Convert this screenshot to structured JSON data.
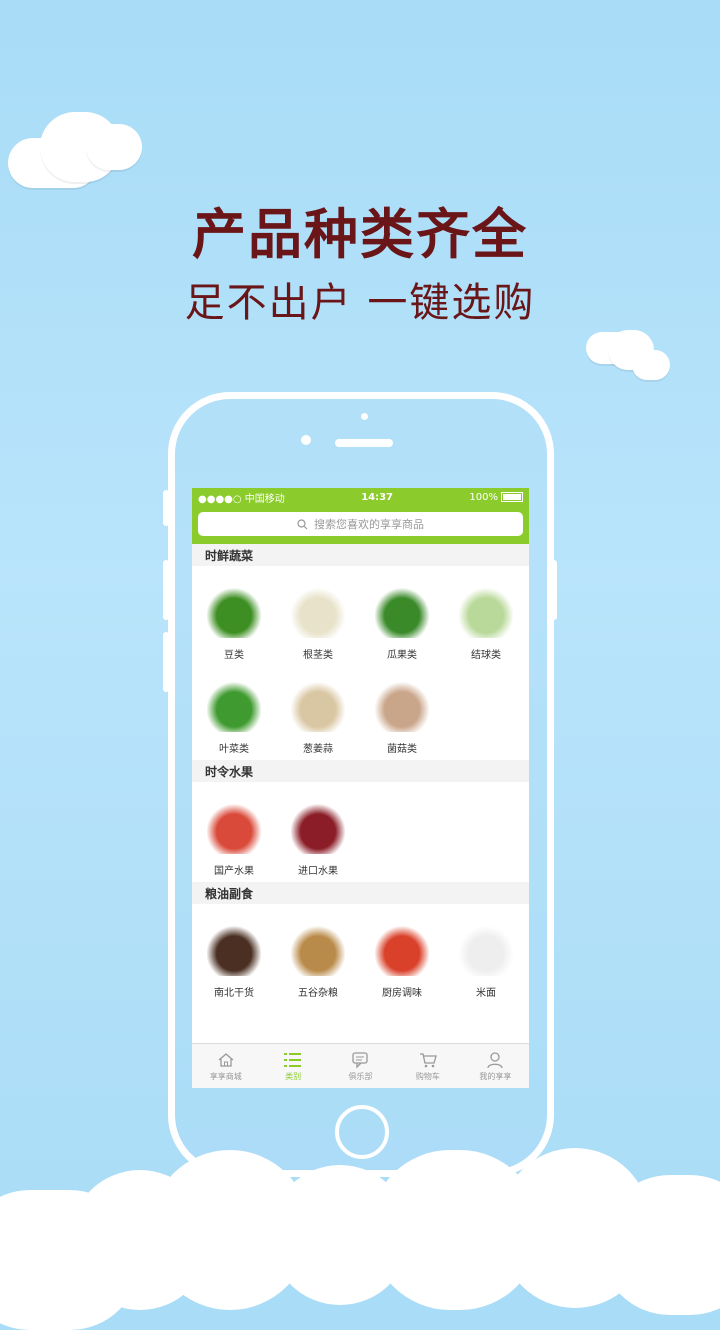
{
  "promo": {
    "title": "产品种类齐全",
    "subtitle": "足不出户 一键选购"
  },
  "status_bar": {
    "carrier": "●●●●○ 中国移动",
    "time": "14:37",
    "battery": "100%"
  },
  "search": {
    "placeholder": "搜索您喜欢的享享商品"
  },
  "sections": [
    {
      "title": "时鲜蔬菜",
      "items": [
        {
          "label": "豆类",
          "color": "#3e8f23"
        },
        {
          "label": "根茎类",
          "color": "#e7e2c9"
        },
        {
          "label": "瓜果类",
          "color": "#3a8a2a"
        },
        {
          "label": "结球类",
          "color": "#b9d99a"
        },
        {
          "label": "叶菜类",
          "color": "#3f9a2f"
        },
        {
          "label": "葱姜蒜",
          "color": "#d9c6a2"
        },
        {
          "label": "菌菇类",
          "color": "#c9a58a"
        }
      ]
    },
    {
      "title": "时令水果",
      "items": [
        {
          "label": "国产水果",
          "color": "#d94a3a"
        },
        {
          "label": "进口水果",
          "color": "#8a1d27"
        }
      ]
    },
    {
      "title": "粮油副食",
      "items": [
        {
          "label": "南北干货",
          "color": "#4a2f22"
        },
        {
          "label": "五谷杂粮",
          "color": "#b98b4a"
        },
        {
          "label": "厨房调味",
          "color": "#d9412a"
        },
        {
          "label": "米面",
          "color": "#eeeeee"
        }
      ]
    }
  ],
  "tabbar": [
    {
      "label": "享享商城",
      "icon": "home-icon"
    },
    {
      "label": "类别",
      "icon": "list-icon"
    },
    {
      "label": "俱乐部",
      "icon": "chat-icon"
    },
    {
      "label": "购物车",
      "icon": "cart-icon"
    },
    {
      "label": "我的享享",
      "icon": "user-icon"
    }
  ],
  "colors": {
    "accent": "#8bcc2c",
    "headline": "#6a1518"
  }
}
